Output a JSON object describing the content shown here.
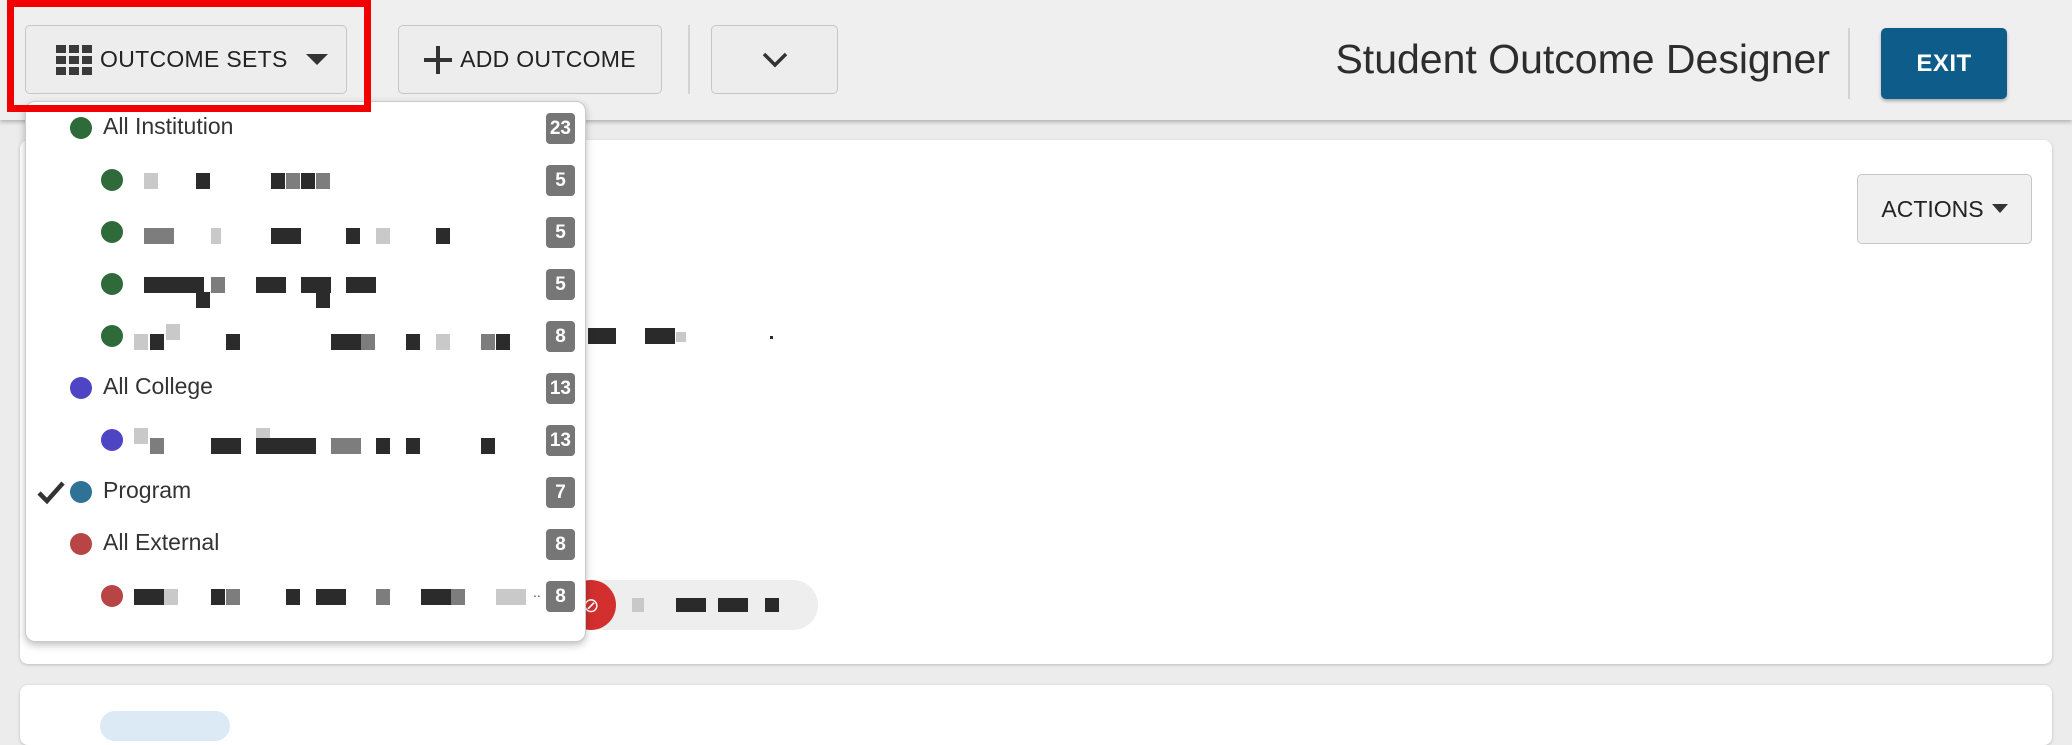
{
  "toolbar": {
    "outcome_sets_label": "OUTCOME SETS",
    "add_outcome_label": "ADD OUTCOME",
    "title": "Student Outcome Designer",
    "exit_label": "EXIT"
  },
  "content": {
    "actions_label": "ACTIONS"
  },
  "dropdown": {
    "items": [
      {
        "label": "All Institution",
        "count": "23",
        "color": "#2f6b3a",
        "level": 0,
        "checked": false
      },
      {
        "label": "",
        "count": "5",
        "color": "#2f6b3a",
        "level": 1,
        "checked": false
      },
      {
        "label": "",
        "count": "5",
        "color": "#2f6b3a",
        "level": 1,
        "checked": false
      },
      {
        "label": "",
        "count": "5",
        "color": "#2f6b3a",
        "level": 1,
        "checked": false
      },
      {
        "label": "",
        "count": "8",
        "color": "#2f6b3a",
        "level": 1,
        "checked": false
      },
      {
        "label": "All College",
        "count": "13",
        "color": "#4e45c4",
        "level": 0,
        "checked": false
      },
      {
        "label": "",
        "count": "13",
        "color": "#4e45c4",
        "level": 1,
        "checked": false
      },
      {
        "label": "Program",
        "count": "7",
        "color": "#2e7395",
        "level": 0,
        "checked": true
      },
      {
        "label": "All External",
        "count": "8",
        "color": "#b94444",
        "level": 0,
        "checked": false
      },
      {
        "label": "",
        "count": "8",
        "color": "#b94444",
        "level": 1,
        "checked": false
      }
    ]
  },
  "icons": {
    "outcome_sets": "grid-icon",
    "caret": "caret-down-icon",
    "add": "plus-icon",
    "chevron": "chevron-down-icon",
    "check": "check-icon",
    "link": "link-icon"
  },
  "colors": {
    "exit_button": "#0e5c8a",
    "highlight": "#f20000",
    "count_badge": "#767676"
  }
}
